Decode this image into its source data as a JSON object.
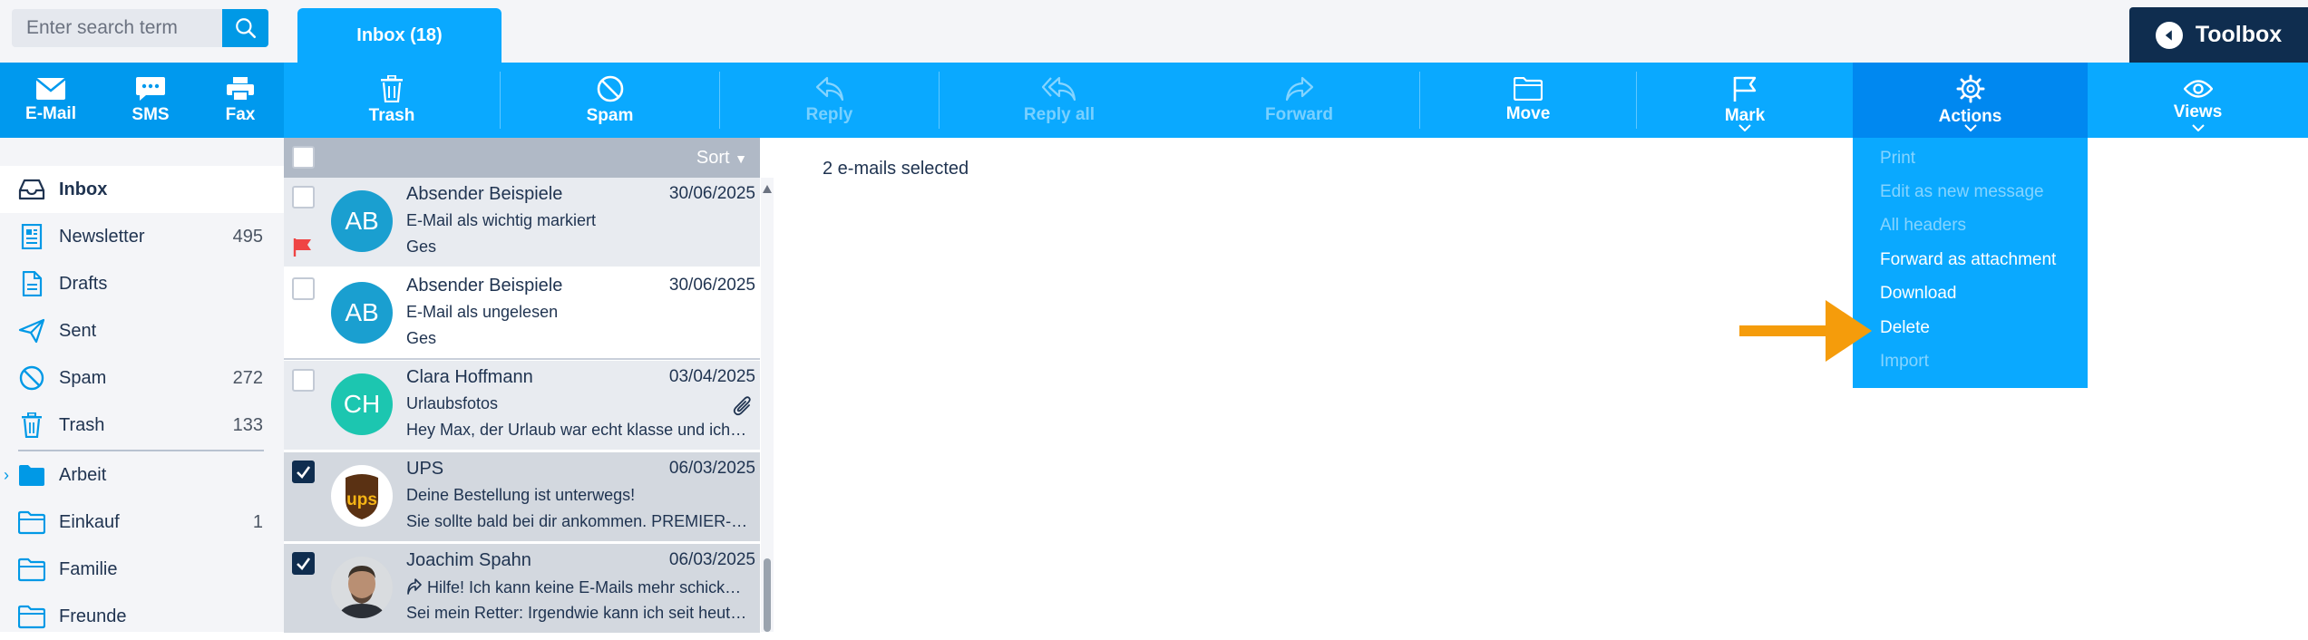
{
  "search": {
    "placeholder": "Enter search term"
  },
  "tabs": [
    {
      "label": "Inbox (18)"
    }
  ],
  "toolbox": {
    "label": "Toolbox"
  },
  "toolbar": {
    "email": "E-Mail",
    "sms": "SMS",
    "fax": "Fax",
    "trash": "Trash",
    "spam": "Spam",
    "reply": "Reply",
    "reply_all": "Reply all",
    "forward": "Forward",
    "move": "Move",
    "mark": "Mark",
    "actions": "Actions",
    "views": "Views"
  },
  "sidebar": {
    "folders": [
      {
        "label": "Inbox",
        "count": "",
        "icon": "inbox-icon",
        "active": true
      },
      {
        "label": "Newsletter",
        "count": "495",
        "icon": "newsletter-icon"
      },
      {
        "label": "Drafts",
        "count": "",
        "icon": "draft-icon"
      },
      {
        "label": "Sent",
        "count": "",
        "icon": "send-icon"
      },
      {
        "label": "Spam",
        "count": "272",
        "icon": "spam-icon"
      },
      {
        "label": "Trash",
        "count": "133",
        "icon": "trash-icon"
      },
      {
        "label": "Arbeit",
        "count": "",
        "icon": "folder-icon"
      },
      {
        "label": "Einkauf",
        "count": "1",
        "icon": "folder-icon"
      },
      {
        "label": "Familie",
        "count": "",
        "icon": "folder-icon"
      },
      {
        "label": "Freunde",
        "count": "",
        "icon": "folder-icon"
      }
    ]
  },
  "list": {
    "sort_label": "Sort",
    "emails": [
      {
        "sender": "Absender Beispiele",
        "date": "30/06/2025",
        "subject": "E-Mail als wichtig markiert",
        "preview": "Ges",
        "avatar": "AB",
        "avatar_color": "#1a9fd0",
        "checked": false,
        "flagged": true
      },
      {
        "sender": "Absender Beispiele",
        "date": "30/06/2025",
        "subject": "E-Mail als ungelesen",
        "preview": "Ges",
        "avatar": "AB",
        "avatar_color": "#1a9fd0",
        "checked": false
      },
      {
        "sender": "Clara Hoffmann",
        "date": "03/04/2025",
        "subject": "Urlaubsfotos",
        "preview": "Hey Max, der Urlaub war echt klasse und ich…",
        "avatar": "CH",
        "avatar_color": "#1cc6b0",
        "checked": false,
        "attachment": true
      },
      {
        "sender": "UPS",
        "date": "06/03/2025",
        "subject": "Deine Bestellung ist unterwegs!",
        "preview": "Sie sollte bald bei dir ankommen. PREMIER-…",
        "avatar": "ups",
        "checked": true
      },
      {
        "sender": "Joachim Spahn",
        "date": "06/03/2025",
        "subject": "Hilfe! Ich kann keine E-Mails mehr schick…",
        "preview": "Sei mein Retter: Irgendwie kann ich seit heut…",
        "avatar": "photo",
        "checked": true,
        "forwarded": true
      }
    ]
  },
  "main": {
    "selection_text": "2 e-mails selected"
  },
  "actions_menu": {
    "items": [
      {
        "label": "Print",
        "enabled": false
      },
      {
        "label": "Edit as new message",
        "enabled": false
      },
      {
        "label": "All headers",
        "enabled": false
      },
      {
        "label": "Forward as attachment",
        "enabled": true
      },
      {
        "label": "Download",
        "enabled": true
      },
      {
        "label": "Delete",
        "enabled": true
      },
      {
        "label": "Import",
        "enabled": false
      }
    ]
  },
  "colors": {
    "accent": "#0aa9ff",
    "dark": "#0f2d4f",
    "arrow": "#f59c0b",
    "flag": "#ef4444"
  }
}
